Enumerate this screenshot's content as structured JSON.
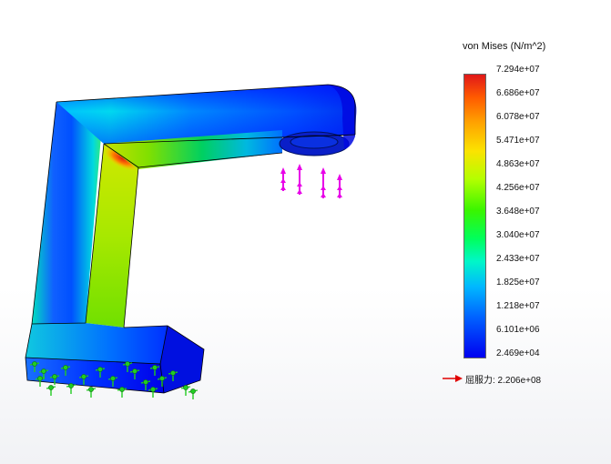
{
  "legend": {
    "title": "von Mises (N/m^2)",
    "ticks": [
      "7.294e+07",
      "6.686e+07",
      "6.078e+07",
      "5.471e+07",
      "4.863e+07",
      "4.256e+07",
      "3.648e+07",
      "3.040e+07",
      "2.433e+07",
      "1.825e+07",
      "1.218e+07",
      "6.101e+06",
      "2.469e+04"
    ]
  },
  "yield": {
    "label": "屈服力: 2.206e+08",
    "marker_color": "#e00000"
  },
  "colors": {
    "max": "#e0181a",
    "min": "#0000f0",
    "load_arrow": "#e800e8",
    "fixture": "#22cc22"
  }
}
